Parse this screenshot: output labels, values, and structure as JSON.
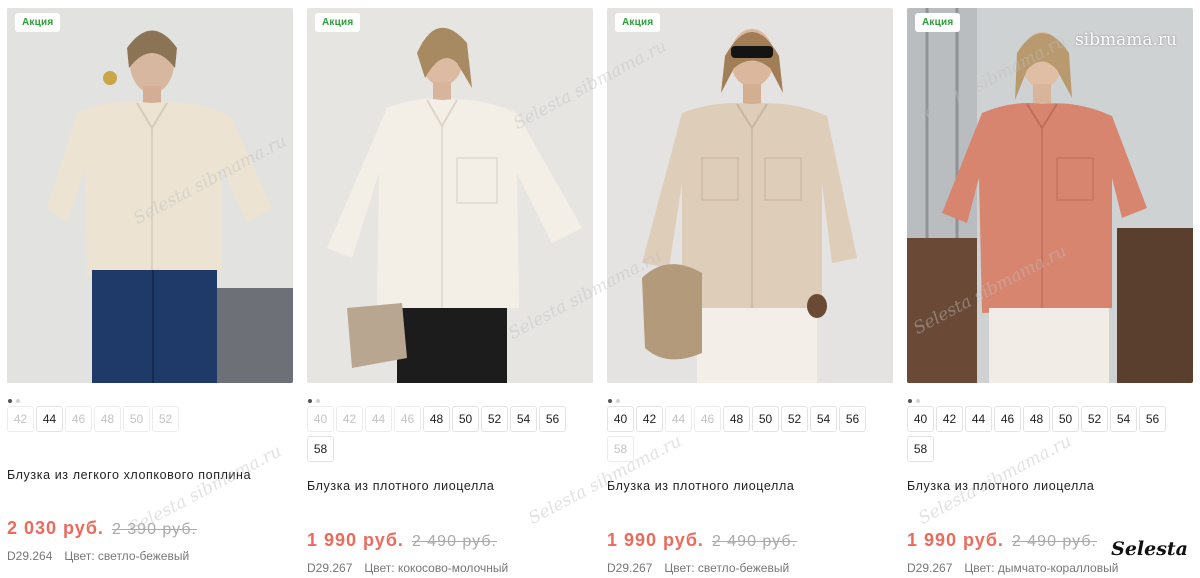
{
  "watermarks": {
    "site": "sibmama.ru",
    "diagonal": "Selesta sibmama.ru",
    "brand": "Selesta"
  },
  "colors": {
    "badge_text": "#2e9e3a",
    "price": "#ec6a5c",
    "old_price": "#aaaaaa"
  },
  "products": [
    {
      "badge": "Акция",
      "title": "Блузка из легкого хлопкового поплина",
      "price": "2 030 руб.",
      "old_price": "2 390 руб.",
      "sku": "D29.264",
      "color": "Цвет: светло-бежевый",
      "sizes": [
        {
          "label": "42",
          "available": false
        },
        {
          "label": "44",
          "available": true
        },
        {
          "label": "46",
          "available": false
        },
        {
          "label": "48",
          "available": false
        },
        {
          "label": "50",
          "available": false
        },
        {
          "label": "52",
          "available": false
        }
      ]
    },
    {
      "badge": "Акция",
      "title": "Блузка из плотного лиоцелла",
      "price": "1 990 руб.",
      "old_price": "2 490 руб.",
      "sku": "D29.267",
      "color": "Цвет: кокосово-молочный",
      "sizes": [
        {
          "label": "40",
          "available": false
        },
        {
          "label": "42",
          "available": false
        },
        {
          "label": "44",
          "available": false
        },
        {
          "label": "46",
          "available": false
        },
        {
          "label": "48",
          "available": true
        },
        {
          "label": "50",
          "available": true
        },
        {
          "label": "52",
          "available": true
        },
        {
          "label": "54",
          "available": true
        },
        {
          "label": "56",
          "available": true
        },
        {
          "label": "58",
          "available": true
        }
      ]
    },
    {
      "badge": "Акция",
      "title": "Блузка из плотного лиоцелла",
      "price": "1 990 руб.",
      "old_price": "2 490 руб.",
      "sku": "D29.267",
      "color": "Цвет: светло-бежевый",
      "sizes": [
        {
          "label": "40",
          "available": true
        },
        {
          "label": "42",
          "available": true
        },
        {
          "label": "44",
          "available": false
        },
        {
          "label": "46",
          "available": false
        },
        {
          "label": "48",
          "available": true
        },
        {
          "label": "50",
          "available": true
        },
        {
          "label": "52",
          "available": true
        },
        {
          "label": "54",
          "available": true
        },
        {
          "label": "56",
          "available": true
        },
        {
          "label": "58",
          "available": false
        }
      ]
    },
    {
      "badge": "Акция",
      "title": "Блузка из плотного лиоцелла",
      "price": "1 990 руб.",
      "old_price": "2 490 руб.",
      "sku": "D29.267",
      "color": "Цвет: дымчато-коралловый",
      "sizes": [
        {
          "label": "40",
          "available": true
        },
        {
          "label": "42",
          "available": true
        },
        {
          "label": "44",
          "available": true
        },
        {
          "label": "46",
          "available": true
        },
        {
          "label": "48",
          "available": true
        },
        {
          "label": "50",
          "available": true
        },
        {
          "label": "52",
          "available": true
        },
        {
          "label": "54",
          "available": true
        },
        {
          "label": "56",
          "available": true
        },
        {
          "label": "58",
          "available": true
        }
      ]
    }
  ]
}
